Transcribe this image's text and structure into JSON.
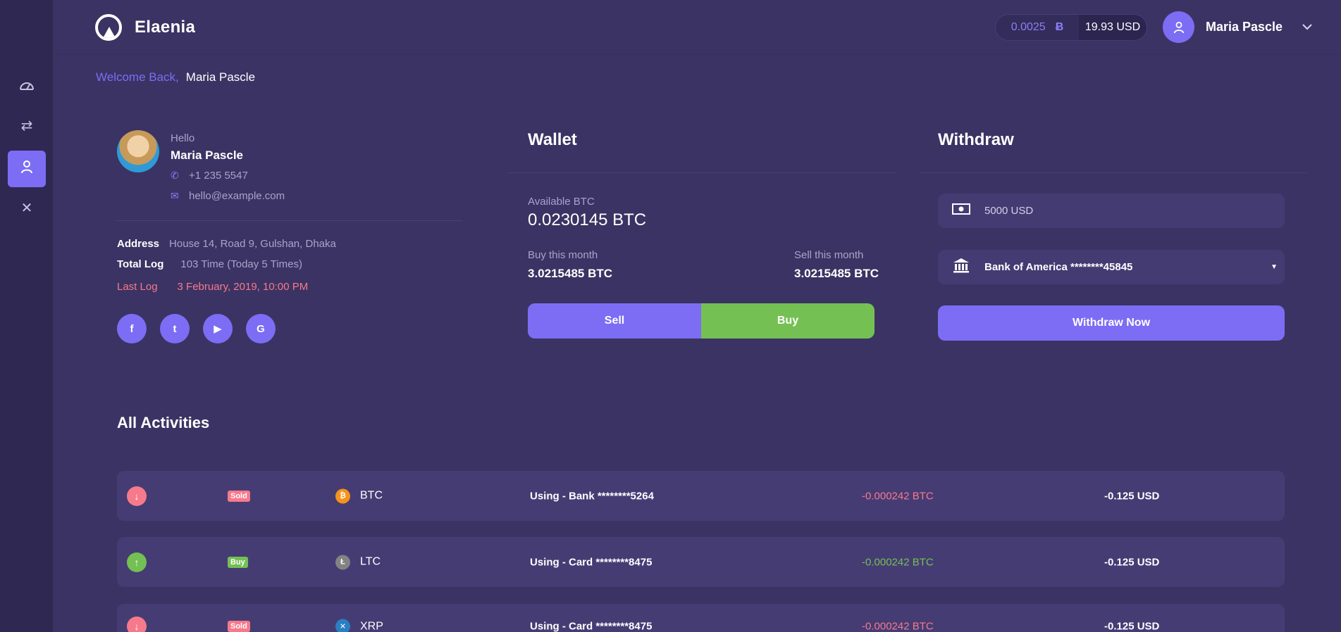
{
  "app": {
    "brand": "Elaenia"
  },
  "header": {
    "btc_balance": "0.0025",
    "btc_symbol": "Ƀ",
    "usd_balance": "19.93 USD",
    "user_name": "Maria Pascle"
  },
  "sidebar": {
    "items": [
      {
        "icon": "dashboard-icon",
        "active": false
      },
      {
        "icon": "exchange-icon",
        "active": false
      },
      {
        "icon": "user-icon",
        "active": true
      },
      {
        "icon": "tools-icon",
        "active": false
      }
    ]
  },
  "welcome": {
    "prefix": "Welcome Back,",
    "name": "Maria Pascle"
  },
  "profile": {
    "hello": "Hello",
    "name": "Maria Pascle",
    "phone": "+1 235 5547",
    "email": "hello@example.com",
    "address_label": "Address",
    "address": "House 14, Road 9, Gulshan, Dhaka",
    "total_log_label": "Total Log",
    "total_log": "103 Time (Today 5 Times)",
    "last_log_label": "Last Log",
    "last_log": "3 February, 2019, 10:00 PM",
    "socials": [
      {
        "icon": "facebook-icon",
        "glyph": "f"
      },
      {
        "icon": "twitter-icon",
        "glyph": "t"
      },
      {
        "icon": "youtube-icon",
        "glyph": "▶"
      },
      {
        "icon": "google-icon",
        "glyph": "G"
      }
    ]
  },
  "wallet": {
    "title": "Wallet",
    "available_label": "Available BTC",
    "available_value": "0.0230145 BTC",
    "buy_month_label": "Buy this month",
    "buy_month_value": "3.0215485 BTC",
    "sell_month_label": "Sell this month",
    "sell_month_value": "3.0215485 BTC",
    "sell_label": "Sell",
    "buy_label": "Buy"
  },
  "withdraw": {
    "title": "Withdraw",
    "amount_value": "5000 USD",
    "bank_value": "Bank of America ********45845",
    "submit_label": "Withdraw Now"
  },
  "activities": {
    "title": "All Activities",
    "rows": [
      {
        "direction": "down",
        "badge": "Sold",
        "coin": "BTC",
        "coin_color": "#f7931a",
        "coin_glyph": "₿",
        "method": "Using - Bank ********5264",
        "amount": "-0.000242 BTC",
        "usd": "-0.125 USD"
      },
      {
        "direction": "up",
        "badge": "Buy",
        "coin": "LTC",
        "coin_color": "#838383",
        "coin_glyph": "Ł",
        "method": "Using - Card ********8475",
        "amount": "-0.000242 BTC",
        "usd": "-0.125 USD"
      },
      {
        "direction": "down",
        "badge": "Sold",
        "coin": "XRP",
        "coin_color": "#2a7fc4",
        "coin_glyph": "✕",
        "method": "Using - Card ********8475",
        "amount": "-0.000242 BTC",
        "usd": "-0.125 USD"
      }
    ]
  },
  "colors": {
    "background": "#3b3363",
    "sidebar": "#2f2853",
    "accent": "#7c6df4",
    "buy_green": "#74c053",
    "sell_red": "#f67a8b"
  }
}
